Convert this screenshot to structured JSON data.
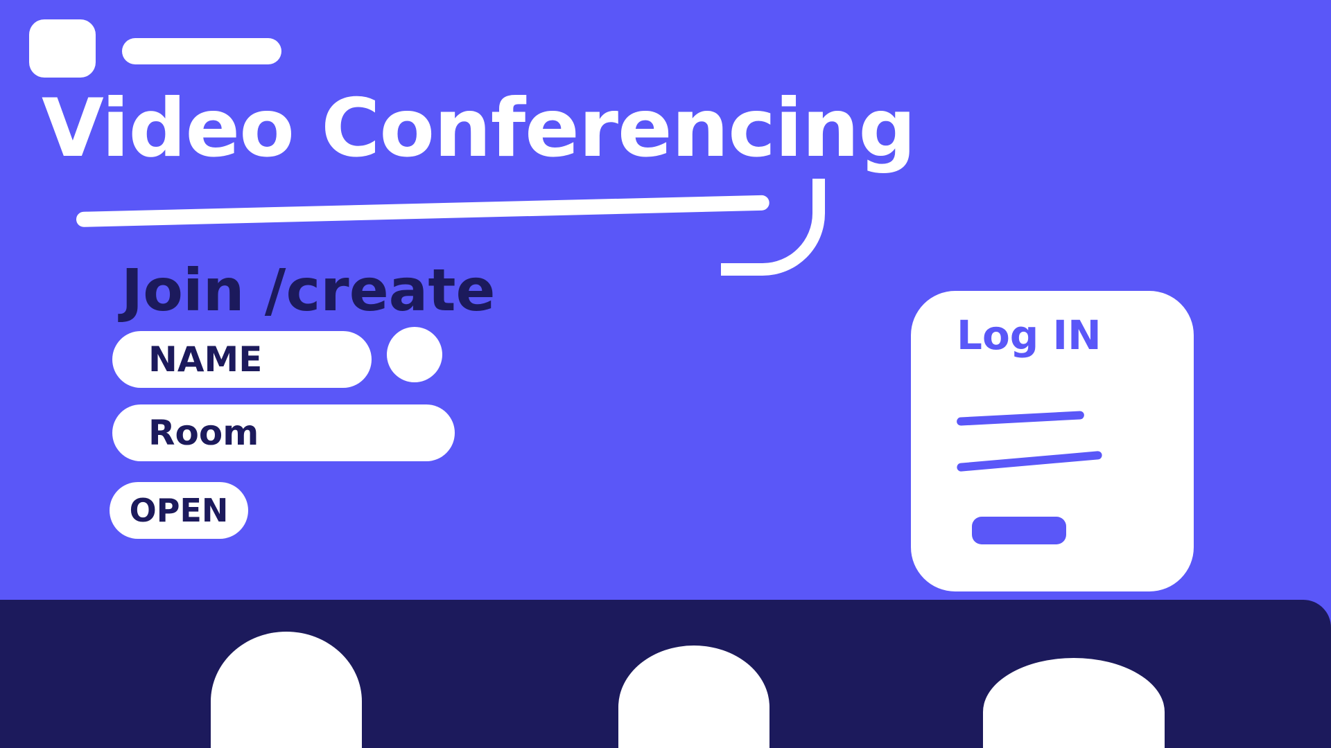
{
  "header": {
    "title": "Video Conferencing"
  },
  "join": {
    "heading": "Join /create",
    "name_placeholder": "NAME",
    "room_placeholder": "Room",
    "open_label": "OPEN"
  },
  "login": {
    "heading": "Log IN",
    "submit_label": ""
  },
  "colors": {
    "background": "#5a57f8",
    "dark": "#1c1a5c",
    "surface": "#ffffff"
  },
  "icons": {
    "logo": "logo-icon",
    "avatar": "avatar-icon",
    "participant": "participant-icon"
  }
}
